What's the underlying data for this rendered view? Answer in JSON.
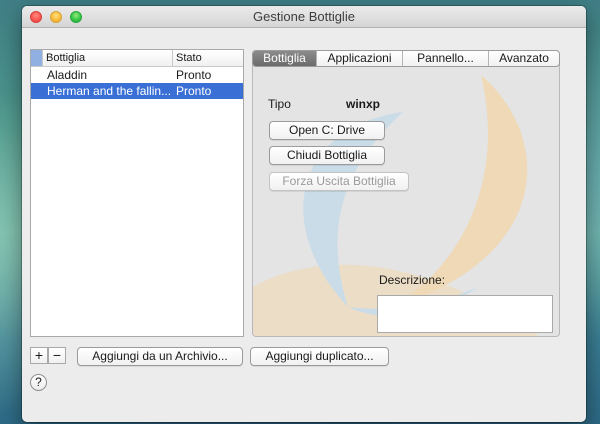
{
  "window": {
    "title": "Gestione Bottiglie"
  },
  "table": {
    "columns": [
      "Bottiglia",
      "Stato"
    ],
    "rows": [
      {
        "name": "Aladdin",
        "state": "Pronto"
      },
      {
        "name": "Herman and the fallin...",
        "state": "Pronto"
      }
    ]
  },
  "list_controls": {
    "add": "+",
    "remove": "−"
  },
  "buttons": {
    "add_from_archive": "Aggiungi da un Archivio...",
    "add_duplicate": "Aggiungi duplicato..."
  },
  "tabs": [
    "Bottiglia",
    "Applicazioni",
    "Pannello...",
    "Avanzato"
  ],
  "bottle_panel": {
    "type_label": "Tipo",
    "type_value": "winxp",
    "open_drive": "Open C: Drive",
    "close_bottle": "Chiudi Bottiglia",
    "force_quit": "Forza Uscita Bottiglia",
    "description_label": "Descrizione:",
    "description_value": ""
  },
  "help": "?",
  "colors": {
    "selection": "#3a6fd5",
    "logo_blue": "#c9dce8",
    "logo_orange": "#efd9b7"
  }
}
